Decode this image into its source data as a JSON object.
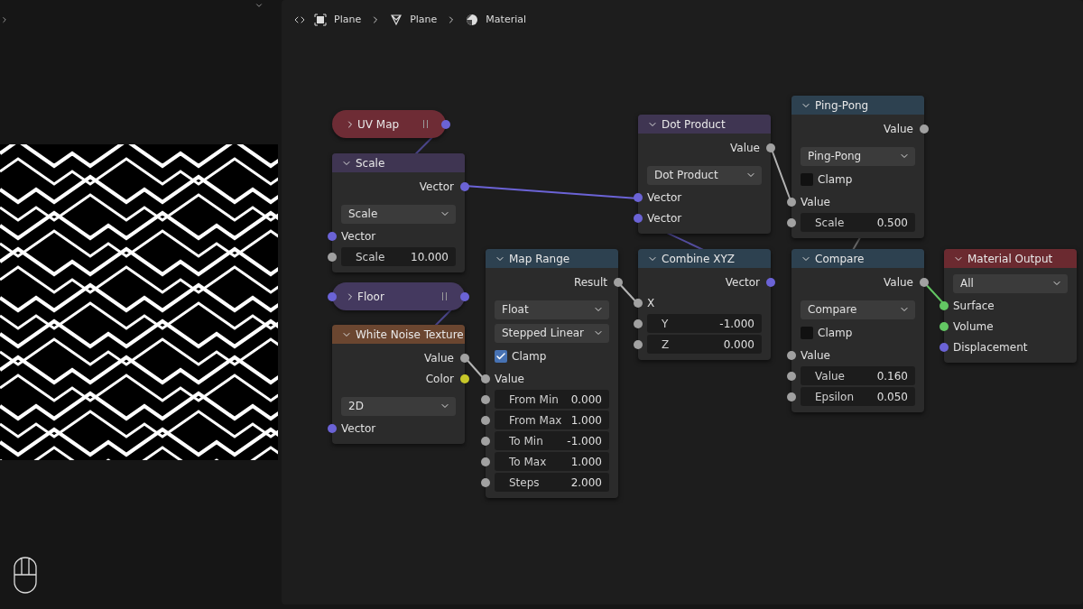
{
  "breadcrumb": [
    {
      "label": "Plane",
      "kind": "object"
    },
    {
      "label": "Plane",
      "kind": "mesh"
    },
    {
      "label": "Material",
      "kind": "material"
    }
  ],
  "nodes": [
    {
      "title": "UV Map",
      "kind": "collapsed",
      "color": "#6e2c35",
      "output_socket": {
        "color": "#6b63d6"
      }
    },
    {
      "title": "Scale",
      "kind": "expanded",
      "color": "#3f3552",
      "rows": [
        {
          "kind": "output",
          "label": "Vector",
          "color": "#6b63d6"
        },
        {
          "kind": "dropdown",
          "value": "Scale"
        },
        {
          "kind": "input",
          "label": "Vector",
          "color": "#6b63d6"
        },
        {
          "kind": "field",
          "label": "Scale",
          "value": "10.000",
          "color": "#a1a1a1"
        }
      ]
    },
    {
      "title": "Floor",
      "kind": "collapsed",
      "color": "#44395f",
      "input_socket": {
        "color": "#6b63d6"
      },
      "output_socket": {
        "color": "#6b63d6"
      }
    },
    {
      "title": "White Noise Texture",
      "kind": "expanded",
      "color": "#6b4630",
      "rows": [
        {
          "kind": "output",
          "label": "Value",
          "color": "#a1a1a1"
        },
        {
          "kind": "output",
          "label": "Color",
          "color": "#c7c729"
        },
        {
          "kind": "dropdown",
          "value": "2D"
        },
        {
          "kind": "input",
          "label": "Vector",
          "color": "#6b63d6"
        }
      ]
    },
    {
      "title": "Map Range",
      "kind": "expanded",
      "color": "#2d4150",
      "rows": [
        {
          "kind": "output",
          "label": "Result",
          "color": "#a1a1a1"
        },
        {
          "kind": "dropdown",
          "value": "Float"
        },
        {
          "kind": "dropdown",
          "value": "Stepped Linear"
        },
        {
          "kind": "checkbox",
          "label": "Clamp",
          "checked": true
        },
        {
          "kind": "input",
          "label": "Value",
          "color": "#a1a1a1"
        },
        {
          "kind": "field",
          "label": "From Min",
          "value": "0.000",
          "color": "#a1a1a1"
        },
        {
          "kind": "field",
          "label": "From Max",
          "value": "1.000",
          "color": "#a1a1a1"
        },
        {
          "kind": "field",
          "label": "To Min",
          "value": "-1.000",
          "color": "#a1a1a1"
        },
        {
          "kind": "field",
          "label": "To Max",
          "value": "1.000",
          "color": "#a1a1a1"
        },
        {
          "kind": "field",
          "label": "Steps",
          "value": "2.000",
          "color": "#a1a1a1"
        }
      ]
    },
    {
      "title": "Dot Product",
      "kind": "expanded",
      "color": "#3f3552",
      "rows": [
        {
          "kind": "output",
          "label": "Value",
          "color": "#a1a1a1"
        },
        {
          "kind": "dropdown",
          "value": "Dot Product"
        },
        {
          "kind": "input",
          "label": "Vector",
          "color": "#6b63d6"
        },
        {
          "kind": "input",
          "label": "Vector",
          "color": "#6b63d6"
        }
      ]
    },
    {
      "title": "Combine XYZ",
      "kind": "expanded",
      "color": "#2d4150",
      "rows": [
        {
          "kind": "output",
          "label": "Vector",
          "color": "#6b63d6"
        },
        {
          "kind": "input",
          "label": "X",
          "color": "#a1a1a1"
        },
        {
          "kind": "field",
          "label": "Y",
          "value": "-1.000",
          "color": "#a1a1a1"
        },
        {
          "kind": "field",
          "label": "Z",
          "value": "0.000",
          "color": "#a1a1a1"
        }
      ]
    },
    {
      "title": "Ping-Pong",
      "kind": "expanded",
      "color": "#2d4150",
      "rows": [
        {
          "kind": "output",
          "label": "Value",
          "color": "#a1a1a1"
        },
        {
          "kind": "dropdown",
          "value": "Ping-Pong"
        },
        {
          "kind": "checkbox",
          "label": "Clamp",
          "checked": false
        },
        {
          "kind": "input",
          "label": "Value",
          "color": "#a1a1a1"
        },
        {
          "kind": "field",
          "label": "Scale",
          "value": "0.500",
          "color": "#a1a1a1"
        }
      ]
    },
    {
      "title": "Compare",
      "kind": "expanded",
      "color": "#2d4150",
      "rows": [
        {
          "kind": "output",
          "label": "Value",
          "color": "#a1a1a1"
        },
        {
          "kind": "dropdown",
          "value": "Compare"
        },
        {
          "kind": "checkbox",
          "label": "Clamp",
          "checked": false
        },
        {
          "kind": "input",
          "label": "Value",
          "color": "#a1a1a1"
        },
        {
          "kind": "field",
          "label": "Value",
          "value": "0.160",
          "color": "#a1a1a1"
        },
        {
          "kind": "field",
          "label": "Epsilon",
          "value": "0.050",
          "color": "#a1a1a1"
        }
      ]
    },
    {
      "title": "Material Output",
      "kind": "expanded",
      "color": "#6b2a30",
      "rows": [
        {
          "kind": "dropdown",
          "value": "All"
        },
        {
          "kind": "input",
          "label": "Surface",
          "color": "#63c763"
        },
        {
          "kind": "input",
          "label": "Volume",
          "color": "#63c763"
        },
        {
          "kind": "input",
          "label": "Displacement",
          "color": "#6b63d6"
        }
      ]
    }
  ]
}
